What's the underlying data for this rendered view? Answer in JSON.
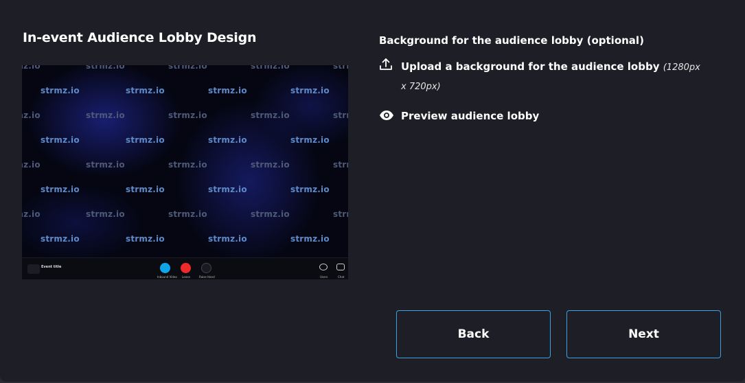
{
  "page": {
    "title": "In-event Audience Lobby Design"
  },
  "lobby_preview": {
    "watermark": "strmz.io",
    "event_title": "Event title",
    "controls": {
      "video_label": "Inbound Video",
      "leave_label": "Leave",
      "raise_hand_label": "Raise Hand",
      "users_label": "Users",
      "chat_label": "Chat"
    },
    "colors": {
      "video_button": "#0ea5e9",
      "leave_button": "#ef2a2a"
    }
  },
  "background_section": {
    "heading": "Background for the audience lobby (optional)",
    "upload_label": "Upload a background for the audience lobby",
    "upload_note": "(1280px x 720px)",
    "upload_icon": "upload-icon",
    "preview_label": "Preview audience lobby",
    "preview_icon": "eye-icon"
  },
  "actions": {
    "back_label": "Back",
    "next_label": "Next"
  },
  "colors": {
    "background": "#1e1f26",
    "button_border": "#3aa3e3",
    "text": "#ffffff"
  }
}
